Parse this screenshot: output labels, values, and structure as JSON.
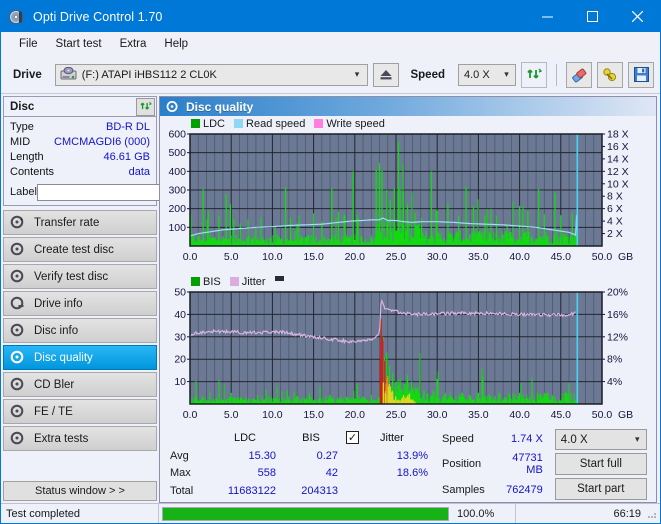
{
  "window": {
    "title": "Opti Drive Control 1.70",
    "icon": "disc-icon",
    "minimize": "–",
    "maximize": "☐",
    "close": "✕"
  },
  "menu": {
    "items": [
      "File",
      "Start test",
      "Extra",
      "Help"
    ]
  },
  "toolbar": {
    "drive_label": "Drive",
    "drive_value": "(F:)  ATAPI iHBS112  2 CL0K",
    "eject_icon": "eject-icon",
    "speed_label": "Speed",
    "speed_value": "4.0 X",
    "refresh_icon": "refresh-icon",
    "eraser_icon": "eraser-icon",
    "tools_icon": "tools-icon",
    "save_icon": "save-icon"
  },
  "disc_panel": {
    "title": "Disc",
    "refresh_icon": "refresh-icon",
    "rows": [
      {
        "key": "Type",
        "value": "BD-R DL"
      },
      {
        "key": "MID",
        "value": "CMCMAGDI6 (000)"
      },
      {
        "key": "Length",
        "value": "46.61 GB"
      },
      {
        "key": "Contents",
        "value": "data"
      }
    ],
    "label_key": "Label",
    "label_value": "",
    "label_placeholder": "",
    "cd_icon": "cd-icon"
  },
  "nav": {
    "items": [
      {
        "label": "Transfer rate",
        "icon": "disc-transfer-icon",
        "selected": false
      },
      {
        "label": "Create test disc",
        "icon": "disc-create-icon",
        "selected": false
      },
      {
        "label": "Verify test disc",
        "icon": "disc-verify-icon",
        "selected": false
      },
      {
        "label": "Drive info",
        "icon": "drive-info-icon",
        "selected": false
      },
      {
        "label": "Disc info",
        "icon": "disc-info-icon",
        "selected": false
      },
      {
        "label": "Disc quality",
        "icon": "disc-quality-icon",
        "selected": true
      },
      {
        "label": "CD Bler",
        "icon": "cd-bler-icon",
        "selected": false
      },
      {
        "label": "FE / TE",
        "icon": "fe-te-icon",
        "selected": false
      },
      {
        "label": "Extra tests",
        "icon": "extra-tests-icon",
        "selected": false
      }
    ],
    "status_window_button": "Status window > >"
  },
  "panel": {
    "title": "Disc quality",
    "icon": "disc-quality-icon"
  },
  "chart_data": [
    {
      "type": "line",
      "name": "top-chart",
      "title": "",
      "xlabel": "GB",
      "ylabel": "",
      "xlim": [
        0,
        50
      ],
      "ylim": [
        0,
        600
      ],
      "y2lim": [
        0,
        18
      ],
      "y2label": "X",
      "grid": true,
      "xticks": [
        "0.0",
        "5.0",
        "10.0",
        "15.0",
        "20.0",
        "25.0",
        "30.0",
        "35.0",
        "40.0",
        "45.0",
        "50.0"
      ],
      "xtick_values": [
        0,
        5,
        10,
        15,
        20,
        25,
        30,
        35,
        40,
        45,
        50
      ],
      "yticks": [
        "100",
        "200",
        "300",
        "400",
        "500",
        "600"
      ],
      "ytick_values": [
        100,
        200,
        300,
        400,
        500,
        600
      ],
      "y2ticks": [
        "2 X",
        "4 X",
        "6 X",
        "8 X",
        "10 X",
        "12 X",
        "14 X",
        "16 X",
        "18 X"
      ],
      "y2tick_values": [
        2,
        4,
        6,
        8,
        10,
        12,
        14,
        16,
        18
      ],
      "legend": [
        {
          "label": "LDC",
          "color": "#00a000"
        },
        {
          "label": "Read speed",
          "color": "#8fd6f7"
        },
        {
          "label": "Write speed",
          "color": "#ff7ee0"
        }
      ],
      "legend_position": "top-left",
      "plot_bg": "#6b7994",
      "series": [
        {
          "name": "Read speed",
          "color": "#9fdcf8",
          "axis": "y2",
          "x": [
            0.0,
            1.0,
            2.5,
            4.0,
            6.0,
            8.0,
            10.0,
            12.0,
            14.0,
            16.0,
            18.0,
            19.5,
            21.0,
            22.0,
            23.0,
            23.4,
            24.0,
            25.0,
            26.0,
            27.0,
            28.0,
            30.0,
            32.0,
            34.0,
            36.0,
            38.0,
            40.0,
            42.0,
            44.0,
            46.0,
            46.9,
            47.0
          ],
          "values": [
            1.6,
            2.0,
            2.3,
            2.6,
            2.8,
            3.0,
            3.1,
            3.3,
            3.4,
            3.5,
            3.8,
            4.0,
            4.1,
            4.2,
            4.2,
            4.5,
            4.1,
            4.1,
            3.9,
            3.8,
            3.9,
            3.9,
            3.8,
            3.6,
            3.5,
            3.4,
            3.2,
            3.0,
            2.6,
            2.2,
            1.7,
            18.0
          ]
        },
        {
          "name": "LDC",
          "color": "#12d912",
          "axis": "y1",
          "note": "dense vertical bar series, baseline ~20-60 rising toward 25GB region, peaks up to 558",
          "baseline": 35,
          "peaks": [
            {
              "x": 1.6,
              "y": 305
            },
            {
              "x": 2.2,
              "y": 190
            },
            {
              "x": 3.5,
              "y": 160
            },
            {
              "x": 4.4,
              "y": 280
            },
            {
              "x": 4.9,
              "y": 225
            },
            {
              "x": 5.3,
              "y": 145
            },
            {
              "x": 6.1,
              "y": 120
            },
            {
              "x": 8.0,
              "y": 95
            },
            {
              "x": 11.6,
              "y": 315
            },
            {
              "x": 12.2,
              "y": 150
            },
            {
              "x": 13.0,
              "y": 120
            },
            {
              "x": 15.0,
              "y": 175
            },
            {
              "x": 16.0,
              "y": 130
            },
            {
              "x": 17.2,
              "y": 310
            },
            {
              "x": 18.0,
              "y": 185
            },
            {
              "x": 19.8,
              "y": 400
            },
            {
              "x": 20.4,
              "y": 150
            },
            {
              "x": 22.6,
              "y": 410
            },
            {
              "x": 23.0,
              "y": 445
            },
            {
              "x": 23.3,
              "y": 405
            },
            {
              "x": 23.9,
              "y": 300
            },
            {
              "x": 24.3,
              "y": 250
            },
            {
              "x": 24.8,
              "y": 310
            },
            {
              "x": 25.3,
              "y": 558
            },
            {
              "x": 25.9,
              "y": 290
            },
            {
              "x": 26.4,
              "y": 230
            },
            {
              "x": 27.3,
              "y": 175
            },
            {
              "x": 28.1,
              "y": 150
            },
            {
              "x": 29.3,
              "y": 400
            },
            {
              "x": 30.0,
              "y": 190
            },
            {
              "x": 31.3,
              "y": 230
            },
            {
              "x": 32.6,
              "y": 160
            },
            {
              "x": 33.5,
              "y": 320
            },
            {
              "x": 34.4,
              "y": 215
            },
            {
              "x": 35.8,
              "y": 165
            },
            {
              "x": 37.2,
              "y": 160
            },
            {
              "x": 38.5,
              "y": 120
            },
            {
              "x": 40.0,
              "y": 215
            },
            {
              "x": 41.0,
              "y": 190
            },
            {
              "x": 42.3,
              "y": 305
            },
            {
              "x": 43.0,
              "y": 170
            },
            {
              "x": 44.3,
              "y": 285
            },
            {
              "x": 45.0,
              "y": 165
            },
            {
              "x": 46.4,
              "y": 175
            }
          ]
        }
      ],
      "cursor_line": {
        "x": 47.0,
        "color": "#45d5f0"
      }
    },
    {
      "type": "line",
      "name": "bottom-chart",
      "title": "",
      "xlabel": "GB",
      "ylabel": "",
      "xlim": [
        0,
        50
      ],
      "ylim": [
        0,
        50
      ],
      "y2lim": [
        0,
        20
      ],
      "y2label": "%",
      "grid": true,
      "xticks": [
        "0.0",
        "5.0",
        "10.0",
        "15.0",
        "20.0",
        "25.0",
        "30.0",
        "35.0",
        "40.0",
        "45.0",
        "50.0"
      ],
      "xtick_values": [
        0,
        5,
        10,
        15,
        20,
        25,
        30,
        35,
        40,
        45,
        50
      ],
      "yticks": [
        "10",
        "20",
        "30",
        "40",
        "50"
      ],
      "ytick_values": [
        10,
        20,
        30,
        40,
        50
      ],
      "y2ticks": [
        "4%",
        "8%",
        "12%",
        "16%",
        "20%"
      ],
      "y2tick_values": [
        4,
        8,
        12,
        16,
        20
      ],
      "legend": [
        {
          "label": "BIS",
          "color": "#00a000"
        },
        {
          "label": "Jitter",
          "color": "#d9aede"
        }
      ],
      "legend_position": "top-left",
      "plot_bg": "#6b7994",
      "series": [
        {
          "name": "Jitter",
          "color": "#d9b4e0",
          "axis": "y2",
          "x": [
            0.0,
            0.5,
            1.5,
            3.0,
            5.0,
            7.0,
            9.0,
            11.0,
            13.0,
            15.0,
            17.0,
            19.0,
            20.5,
            22.0,
            23.0,
            23.2,
            23.5,
            24.0,
            25.0,
            26.0,
            27.0,
            28.0,
            30.0,
            32.0,
            34.0,
            36.0,
            38.0,
            40.0,
            42.0,
            44.0,
            46.0,
            46.9
          ],
          "values": [
            12.0,
            12.6,
            12.8,
            13.0,
            12.9,
            12.7,
            12.8,
            12.9,
            12.4,
            12.0,
            11.6,
            11.2,
            11.2,
            11.4,
            12.4,
            18.7,
            17.4,
            16.8,
            16.5,
            16.3,
            16.1,
            16.0,
            16.1,
            16.2,
            16.2,
            16.2,
            16.1,
            16.0,
            16.0,
            15.9,
            15.9,
            16.3
          ]
        },
        {
          "name": "BIS",
          "color": "#12d912",
          "axis": "y1",
          "note": "dense vertical bar series, low baseline ~1-3 with burst cluster near 23-27 GB reaching 38 max",
          "baseline": 2,
          "peaks": [
            {
              "x": 2.4,
              "y": 5
            },
            {
              "x": 5.0,
              "y": 5
            },
            {
              "x": 8.2,
              "y": 4
            },
            {
              "x": 11.8,
              "y": 6
            },
            {
              "x": 14.5,
              "y": 5
            },
            {
              "x": 17.0,
              "y": 4
            },
            {
              "x": 20.3,
              "y": 9
            },
            {
              "x": 22.0,
              "y": 4
            },
            {
              "x": 23.2,
              "y": 38
            },
            {
              "x": 23.4,
              "y": 30
            },
            {
              "x": 23.6,
              "y": 21
            },
            {
              "x": 23.9,
              "y": 23
            },
            {
              "x": 24.2,
              "y": 17
            },
            {
              "x": 24.6,
              "y": 14
            },
            {
              "x": 25.0,
              "y": 10
            },
            {
              "x": 25.5,
              "y": 11
            },
            {
              "x": 26.0,
              "y": 9
            },
            {
              "x": 26.4,
              "y": 13
            },
            {
              "x": 26.9,
              "y": 10
            },
            {
              "x": 27.5,
              "y": 7
            },
            {
              "x": 28.4,
              "y": 6
            },
            {
              "x": 29.5,
              "y": 6
            },
            {
              "x": 31.0,
              "y": 5
            },
            {
              "x": 33.0,
              "y": 5
            },
            {
              "x": 35.0,
              "y": 5
            },
            {
              "x": 37.5,
              "y": 5
            },
            {
              "x": 40.0,
              "y": 5
            },
            {
              "x": 43.0,
              "y": 5
            },
            {
              "x": 45.5,
              "y": 5
            }
          ]
        }
      ],
      "cursor_line": {
        "x": 47.0,
        "color": "#45d5f0"
      }
    }
  ],
  "stats": {
    "headers": {
      "ldc": "LDC",
      "bis": "BIS",
      "jitter": "Jitter"
    },
    "rows": [
      {
        "label": "Avg",
        "ldc": "15.30",
        "bis": "0.27",
        "jitter": "13.9%"
      },
      {
        "label": "Max",
        "ldc": "558",
        "bis": "42",
        "jitter": "18.6%"
      },
      {
        "label": "Total",
        "ldc": "11683122",
        "bis": "204313",
        "jitter": ""
      }
    ],
    "jitter_checked": true,
    "jitter_check_glyph": "✓",
    "speed_label": "Speed",
    "speed_value": "1.74 X",
    "position_label": "Position",
    "position_value": "47731 MB",
    "samples_label": "Samples",
    "samples_value": "762479",
    "speed_select": "4.0 X",
    "start_full_button": "Start full",
    "start_part_button": "Start part"
  },
  "statusbar": {
    "message": "Test completed",
    "progress_percent_text": "100.0%",
    "progress_value": 100,
    "elapsed": "66:19"
  }
}
